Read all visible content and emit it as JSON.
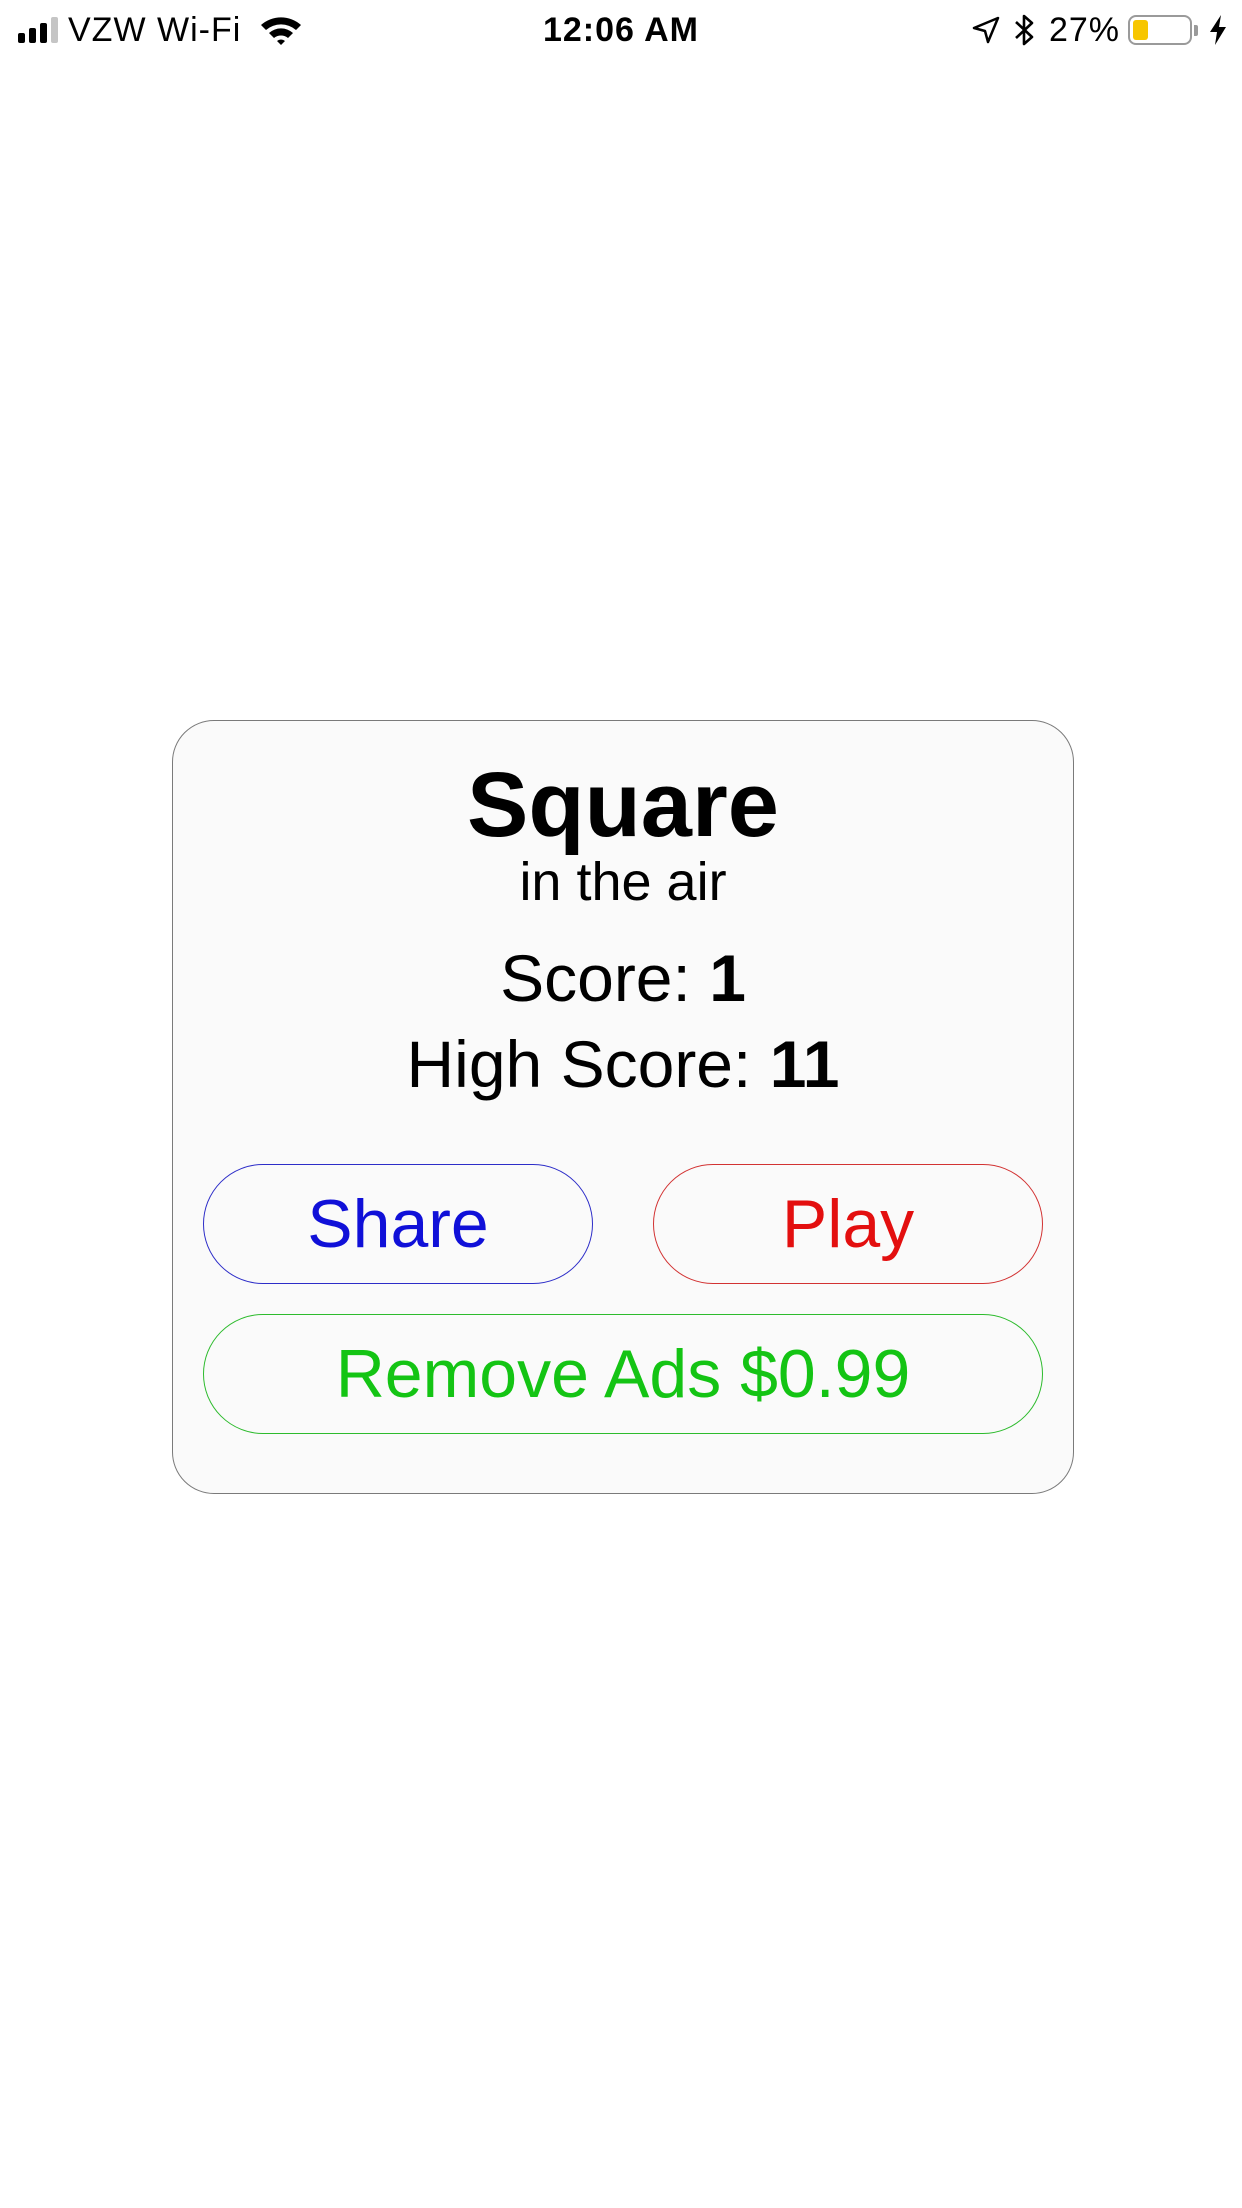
{
  "status_bar": {
    "carrier": "VZW Wi-Fi",
    "time": "12:06 AM",
    "battery_percent": "27%",
    "battery_level": 0.27,
    "signal_bars_filled": 3,
    "signal_bars_total": 4,
    "icons": [
      "signal-icon",
      "wifi-icon",
      "location-arrow-icon",
      "bluetooth-icon",
      "battery-icon",
      "charging-bolt-icon"
    ]
  },
  "game": {
    "title": "Square",
    "subtitle": "in the air",
    "score_label": "Score: ",
    "score_value": "1",
    "high_score_label": "High Score: ",
    "high_score_value": "11"
  },
  "buttons": {
    "share": "Share",
    "play": "Play",
    "remove_ads": "Remove Ads $0.99"
  },
  "colors": {
    "share": "#1010d8",
    "play": "#e30f0f",
    "remove_ads": "#14c414",
    "battery_fill": "#f7c600",
    "card_background": "#fafafa"
  }
}
